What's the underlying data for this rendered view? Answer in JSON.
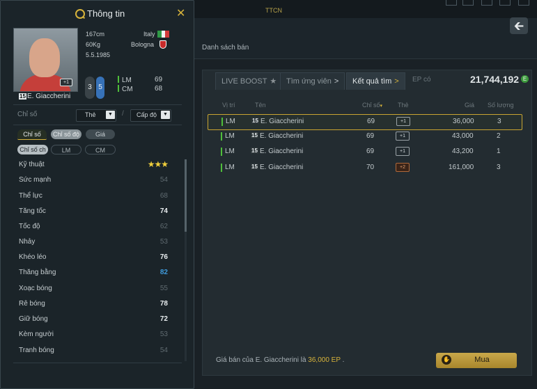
{
  "topbar": {
    "label": "TTCN"
  },
  "market": {
    "sale_list_tab": "Danh sách bán",
    "tabs": [
      {
        "label": "LIVE BOOST",
        "icon": "star-icon"
      },
      {
        "label": "Tìm ứng viên",
        "icon": "chevron-right-icon"
      },
      {
        "label": "Kết quả tìm",
        "icon": "chevron-right-icon"
      }
    ],
    "ep_label": "EP có",
    "ep_value": "21,744,192",
    "ep_coin": "E",
    "columns": [
      "Vị trí",
      "Tên",
      "Chỉ số",
      "Thẻ",
      "Giá",
      "Số lượng"
    ],
    "rows": [
      {
        "pos": "LM",
        "ovr": "15",
        "name": "E. Giaccherini",
        "stat": "69",
        "card": "+1",
        "price": "36,000",
        "qty": "3"
      },
      {
        "pos": "LM",
        "ovr": "15",
        "name": "E. Giaccherini",
        "stat": "69",
        "card": "+1",
        "price": "43,000",
        "qty": "2"
      },
      {
        "pos": "LM",
        "ovr": "15",
        "name": "E. Giaccherini",
        "stat": "69",
        "card": "+1",
        "price": "43,200",
        "qty": "1"
      },
      {
        "pos": "LM",
        "ovr": "15",
        "name": "E. Giaccherini",
        "stat": "70",
        "card": "+2",
        "price": "161,000",
        "qty": "3"
      }
    ],
    "footer_prefix": "Giá bán của E. Giaccherini là",
    "footer_price": "36,000 EP",
    "footer_suffix": ".",
    "buy_label": "Mua"
  },
  "panel": {
    "title": "Thông tin",
    "player_name": "E. Giaccherini",
    "player_ovr": "15",
    "photo_badge": "+1",
    "height": "167cm",
    "weight": "60Kg",
    "dob": "5.5.1985",
    "nation": "Italy",
    "club": "Bologna",
    "pos_ovr": "3",
    "pos_boost": "5",
    "positions": [
      {
        "name": "LM",
        "value": "69"
      },
      {
        "name": "CM",
        "value": "68"
      }
    ],
    "chiso_label": "Chỉ số",
    "dropdown_card": "Thẻ",
    "dropdown_level": "Cấp độ",
    "tabs": [
      "Chỉ số",
      "Chỉ số độ",
      "Giá"
    ],
    "subtabs": [
      "Chỉ số ch",
      "LM",
      "CM"
    ],
    "attributes": [
      {
        "name": "Kỹ thuật",
        "value": "★★★"
      },
      {
        "name": "Sức mạnh",
        "value": "54"
      },
      {
        "name": "Thể lực",
        "value": "68"
      },
      {
        "name": "Tăng tốc",
        "value": "74"
      },
      {
        "name": "Tốc độ",
        "value": "62"
      },
      {
        "name": "Nhảy",
        "value": "53"
      },
      {
        "name": "Khéo léo",
        "value": "76"
      },
      {
        "name": "Thăng bằng",
        "value": "82"
      },
      {
        "name": "Xoạc bóng",
        "value": "55"
      },
      {
        "name": "Rê bóng",
        "value": "78"
      },
      {
        "name": "Giữ bóng",
        "value": "72"
      },
      {
        "name": "Kèm người",
        "value": "53"
      },
      {
        "name": "Tranh bóng",
        "value": "54"
      }
    ]
  },
  "colors": {
    "accent_gold": "#d7b33b",
    "position_green": "#4fbf3a",
    "highlight_blue": "#3f9bdc"
  }
}
